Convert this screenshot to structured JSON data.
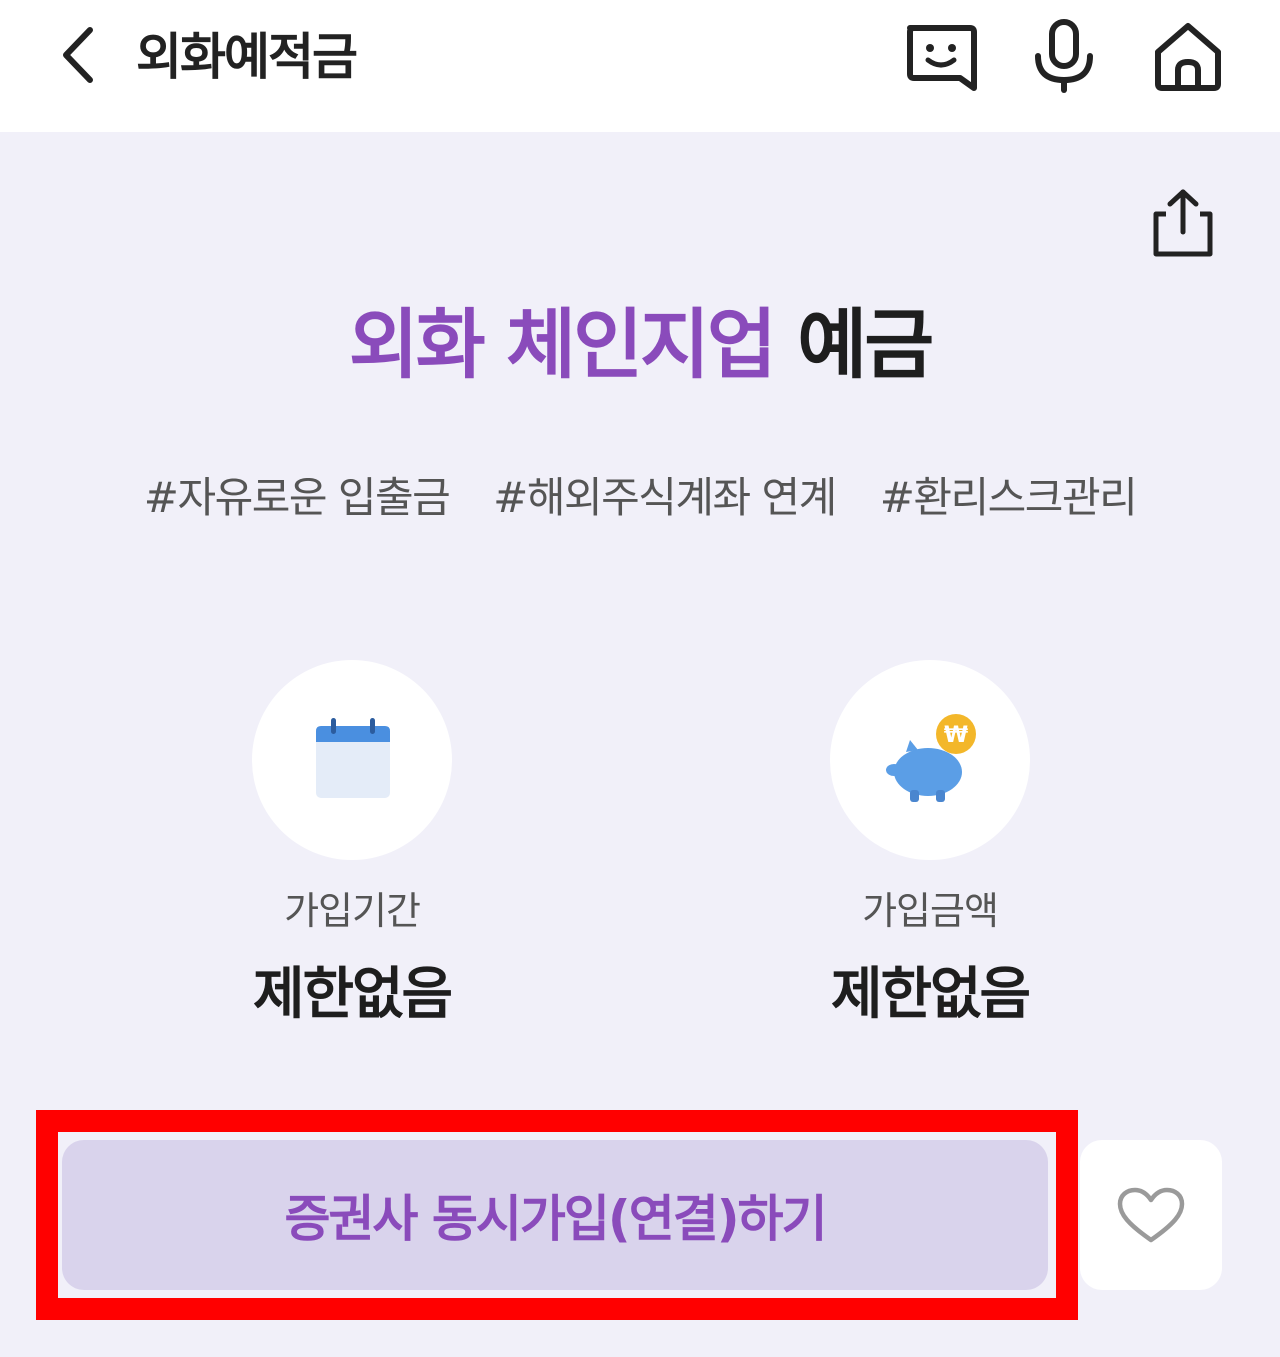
{
  "header": {
    "title": "외화예적금",
    "icons": {
      "back": "chevron-left-icon",
      "chat": "chatbot-icon",
      "voice": "microphone-icon",
      "home": "home-icon"
    }
  },
  "share_icon": "share-icon",
  "product": {
    "title_accent": "외화 체인지업",
    "title_rest": " 예금",
    "tags": [
      "#자유로운 입출금",
      "#해외주식계좌 연계",
      "#환리스크관리"
    ]
  },
  "info": {
    "period": {
      "label": "가입기간",
      "value": "제한없음",
      "icon": "calendar-icon"
    },
    "amount": {
      "label": "가입금액",
      "value": "제한없음",
      "icon": "piggy-bank-icon"
    }
  },
  "actions": {
    "join_label": "증권사 동시가입(연결)하기",
    "favorite_icon": "heart-icon"
  },
  "colors": {
    "accent": "#8a4bbb",
    "background": "#f1f0f9",
    "join_button_bg": "#d9d3ec",
    "highlight": "#ff0000"
  }
}
